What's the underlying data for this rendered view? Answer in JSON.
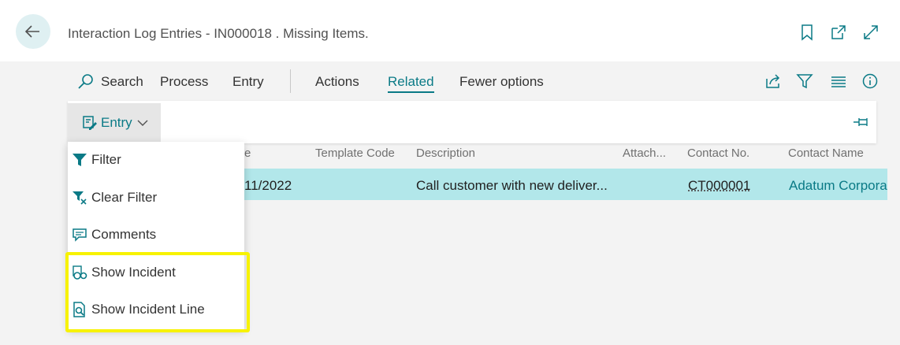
{
  "header": {
    "title": "Interaction Log Entries - IN000018 . Missing Items."
  },
  "actions": {
    "search": "Search",
    "process": "Process",
    "entry": "Entry",
    "actions": "Actions",
    "related": "Related",
    "fewer_options": "Fewer options"
  },
  "subbar": {
    "entry_label": "Entry"
  },
  "grid": {
    "columns": [
      "e",
      "Template Code",
      "Description",
      "Attach...",
      "Contact No.",
      "Contact Name"
    ],
    "row": {
      "date": "11/2022",
      "description": "Call customer with new deliver...",
      "contact_no": "CT000001",
      "contact_name": "Adatum Corpora"
    }
  },
  "dropdown": {
    "items": [
      {
        "label": "Filter",
        "icon": "filter-icon"
      },
      {
        "label": "Clear Filter",
        "icon": "clear-filter-icon"
      },
      {
        "label": "Comments",
        "icon": "comments-icon"
      },
      {
        "label": "Show Incident",
        "icon": "incident-icon"
      },
      {
        "label": "Show Incident Line",
        "icon": "incident-line-icon"
      }
    ]
  },
  "colors": {
    "accent": "#0a7a86",
    "row_selected": "#b2e7ea",
    "highlight": "#f7f200"
  }
}
